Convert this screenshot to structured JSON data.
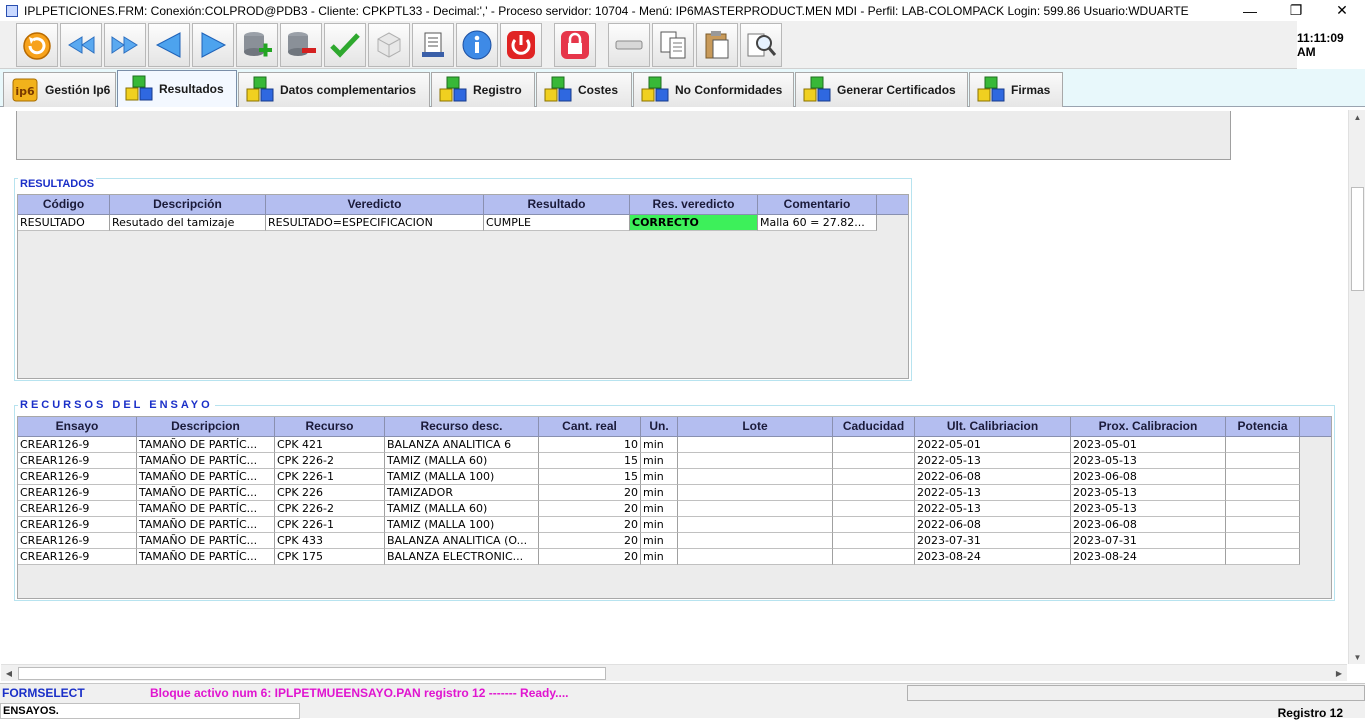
{
  "window": {
    "title": "IPLPETICIONES.FRM:     Conexión:COLPROD@PDB3 - Cliente: CPKPTL33 - Decimal:',' - Proceso servidor: 10704 - Menú: IP6MASTERPRODUCT.MEN MDI - Perfil: LAB-COLOMPACK Login: 599.86      Usuario:WDUARTE",
    "minimize": "—",
    "restore": "❐",
    "close": "✕"
  },
  "toolbar": {
    "clock": "11:11:09 AM",
    "buttons": [
      {
        "name": "refresh-icon"
      },
      {
        "name": "rewind-icon"
      },
      {
        "name": "fast-forward-icon"
      },
      {
        "name": "previous-icon"
      },
      {
        "name": "next-icon"
      },
      {
        "name": "add-record-icon"
      },
      {
        "name": "delete-record-icon"
      },
      {
        "name": "accept-icon"
      },
      {
        "name": "cube-icon"
      },
      {
        "name": "report-icon"
      },
      {
        "name": "info-icon"
      },
      {
        "name": "power-icon"
      },
      {
        "name": "lock-icon"
      },
      {
        "name": "eraser-icon"
      },
      {
        "name": "copy-icon"
      },
      {
        "name": "paste-icon"
      },
      {
        "name": "search-icon"
      }
    ]
  },
  "tabs": [
    {
      "label": "Gestión Ip6",
      "icon": "ip6-logo-icon"
    },
    {
      "label": "Resultados",
      "icon": "cubes-icon",
      "active": true
    },
    {
      "label": "Datos complementarios",
      "icon": "cubes-icon"
    },
    {
      "label": "Registro",
      "icon": "cubes-icon"
    },
    {
      "label": "Costes",
      "icon": "cubes-icon"
    },
    {
      "label": "No Conformidades",
      "icon": "cubes-icon"
    },
    {
      "label": "Generar Certificados",
      "icon": "cubes-icon"
    },
    {
      "label": "Firmas",
      "icon": "cubes-icon"
    }
  ],
  "resultados": {
    "title": "RESULTADOS",
    "headers": [
      "Código",
      "Descripción",
      "Veredicto",
      "Resultado",
      "Res. veredicto",
      "Comentario"
    ],
    "rows": [
      [
        "RESULTADO",
        "Resutado del tamizaje",
        "RESULTADO=ESPECIFICACION",
        "CUMPLE",
        "CORRECTO",
        "Malla 60 = 27.82..."
      ]
    ],
    "ok_color": "#3df05a"
  },
  "recursos": {
    "title": "RECURSOS DEL ENSAYO",
    "headers": [
      "Ensayo",
      "Descripcion",
      "Recurso",
      "Recurso desc.",
      "Cant. real",
      "Un.",
      "Lote",
      "Caducidad",
      "Ult. Calibriacion",
      "Prox. Calibracion",
      "Potencia"
    ],
    "rows": [
      [
        "CREAR126-9",
        "TAMAÑO DE PARTÍC...",
        "CPK 421",
        "BALANZA ANALITICA 6",
        "10",
        "min",
        "",
        "",
        "2022-05-01",
        "2023-05-01",
        ""
      ],
      [
        "CREAR126-9",
        "TAMAÑO DE PARTÍC...",
        "CPK 226-2",
        "TAMIZ (MALLA 60)",
        "15",
        "min",
        "",
        "",
        "2022-05-13",
        "2023-05-13",
        ""
      ],
      [
        "CREAR126-9",
        "TAMAÑO DE PARTÍC...",
        "CPK 226-1",
        "TAMIZ (MALLA 100)",
        "15",
        "min",
        "",
        "",
        "2022-06-08",
        "2023-06-08",
        ""
      ],
      [
        "CREAR126-9",
        "TAMAÑO DE PARTÍC...",
        "CPK 226",
        "TAMIZADOR",
        "20",
        "min",
        "",
        "",
        "2022-05-13",
        "2023-05-13",
        ""
      ],
      [
        "CREAR126-9",
        "TAMAÑO DE PARTÍC...",
        "CPK 226-2",
        "TAMIZ (MALLA 60)",
        "20",
        "min",
        "",
        "",
        "2022-05-13",
        "2023-05-13",
        ""
      ],
      [
        "CREAR126-9",
        "TAMAÑO DE PARTÍC...",
        "CPK 226-1",
        "TAMIZ (MALLA 100)",
        "20",
        "min",
        "",
        "",
        "2022-06-08",
        "2023-06-08",
        ""
      ],
      [
        "CREAR126-9",
        "TAMAÑO DE PARTÍC...",
        "CPK 433",
        "BALANZA ANALITICA (O...",
        "20",
        "min",
        "",
        "",
        "2023-07-31",
        "2023-07-31",
        ""
      ],
      [
        "CREAR126-9",
        "TAMAÑO DE PARTÍC...",
        "CPK 175",
        "BALANZA ELECTRONIC...",
        "20",
        "min",
        "",
        "",
        "2023-08-24",
        "2023-08-24",
        ""
      ]
    ]
  },
  "status": {
    "form": "FORMSELECT",
    "message": "Bloque activo num 6: IPLPETMUEENSAYO.PAN  registro 12 ------- Ready....",
    "section": "ENSAYOS.",
    "record": "Registro 12"
  }
}
